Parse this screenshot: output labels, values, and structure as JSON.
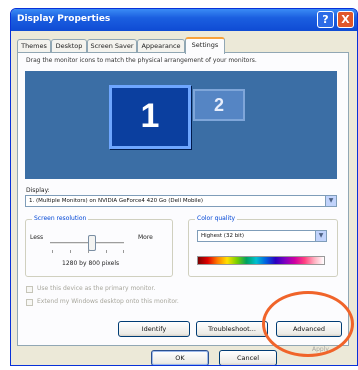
{
  "window": {
    "title": "Display Properties",
    "help_label": "?",
    "close_label": "X"
  },
  "tabs": [
    {
      "label": "Themes"
    },
    {
      "label": "Desktop"
    },
    {
      "label": "Screen Saver"
    },
    {
      "label": "Appearance"
    },
    {
      "label": "Settings",
      "active": true
    }
  ],
  "settings": {
    "instruction": "Drag the monitor icons to match the physical arrangement of your monitors.",
    "monitors": [
      {
        "label": "1",
        "selected": true
      },
      {
        "label": "2",
        "selected": false
      }
    ],
    "display_label": "Display:",
    "display_value": "1. (Multiple Monitors) on NVIDIA GeForce4 420 Go (Dell Mobile)",
    "resolution": {
      "title": "Screen resolution",
      "less_label": "Less",
      "more_label": "More",
      "value": "1280 by 800 pixels"
    },
    "color_quality": {
      "title": "Color quality",
      "value": "Highest (32 bit)"
    },
    "checkboxes": [
      {
        "label": "Use this device as the primary monitor.",
        "checked": true,
        "enabled": false
      },
      {
        "label": "Extend my Windows desktop onto this monitor.",
        "checked": true,
        "enabled": false
      }
    ],
    "buttons": {
      "identify": "Identify",
      "troubleshoot": "Troubleshoot...",
      "advanced": "Advanced"
    }
  },
  "footer": {
    "ok": "OK",
    "cancel": "Cancel",
    "apply": "Apply"
  },
  "colors": {
    "titlebar": "#1b5fe0",
    "desktop_preview": "#3b6ea5",
    "highlight_ring": "#f0642a"
  }
}
